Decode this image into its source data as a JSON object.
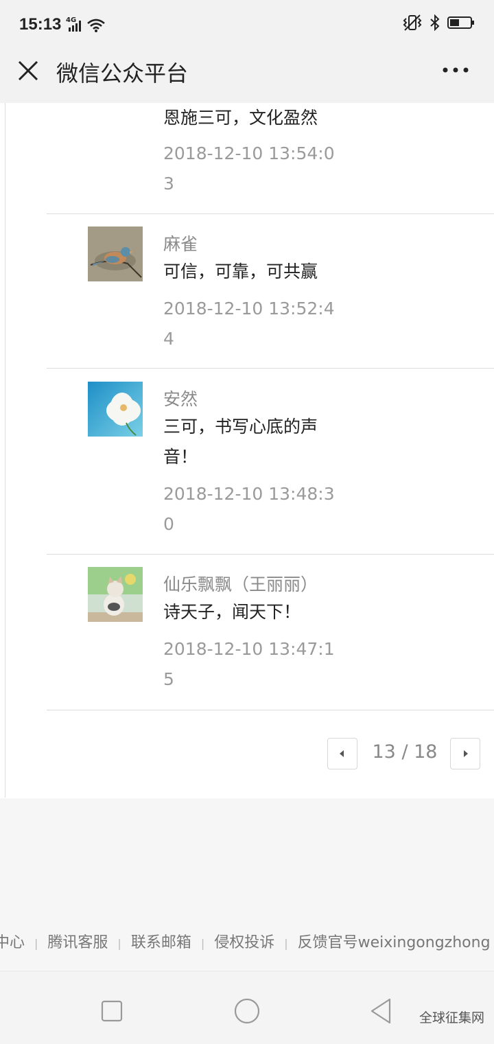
{
  "status": {
    "time": "15:13",
    "network": "4G"
  },
  "header": {
    "title": "微信公众平台"
  },
  "comments": [
    {
      "name": "",
      "text": "恩施三可，文化盈然",
      "time": "2018-12-10 13:54:03"
    },
    {
      "name": "麻雀",
      "text": "可信，可靠，可共赢",
      "time": "2018-12-10 13:52:44",
      "avatar": "bird"
    },
    {
      "name": "安然",
      "text": "三可，书写心底的声音！",
      "time": "2018-12-10 13:48:30",
      "avatar": "flower"
    },
    {
      "name": "仙乐飘飘（王丽丽）",
      "text": "诗天子，闻天下！",
      "time": "2018-12-10 13:47:15",
      "avatar": "cat"
    }
  ],
  "pagination": {
    "text": "13 / 18"
  },
  "footer": {
    "links": [
      "中心",
      "腾讯客服",
      "联系邮箱",
      "侵权投诉",
      "反馈官号weixingongzhong"
    ]
  },
  "watermark": "全球征集网"
}
